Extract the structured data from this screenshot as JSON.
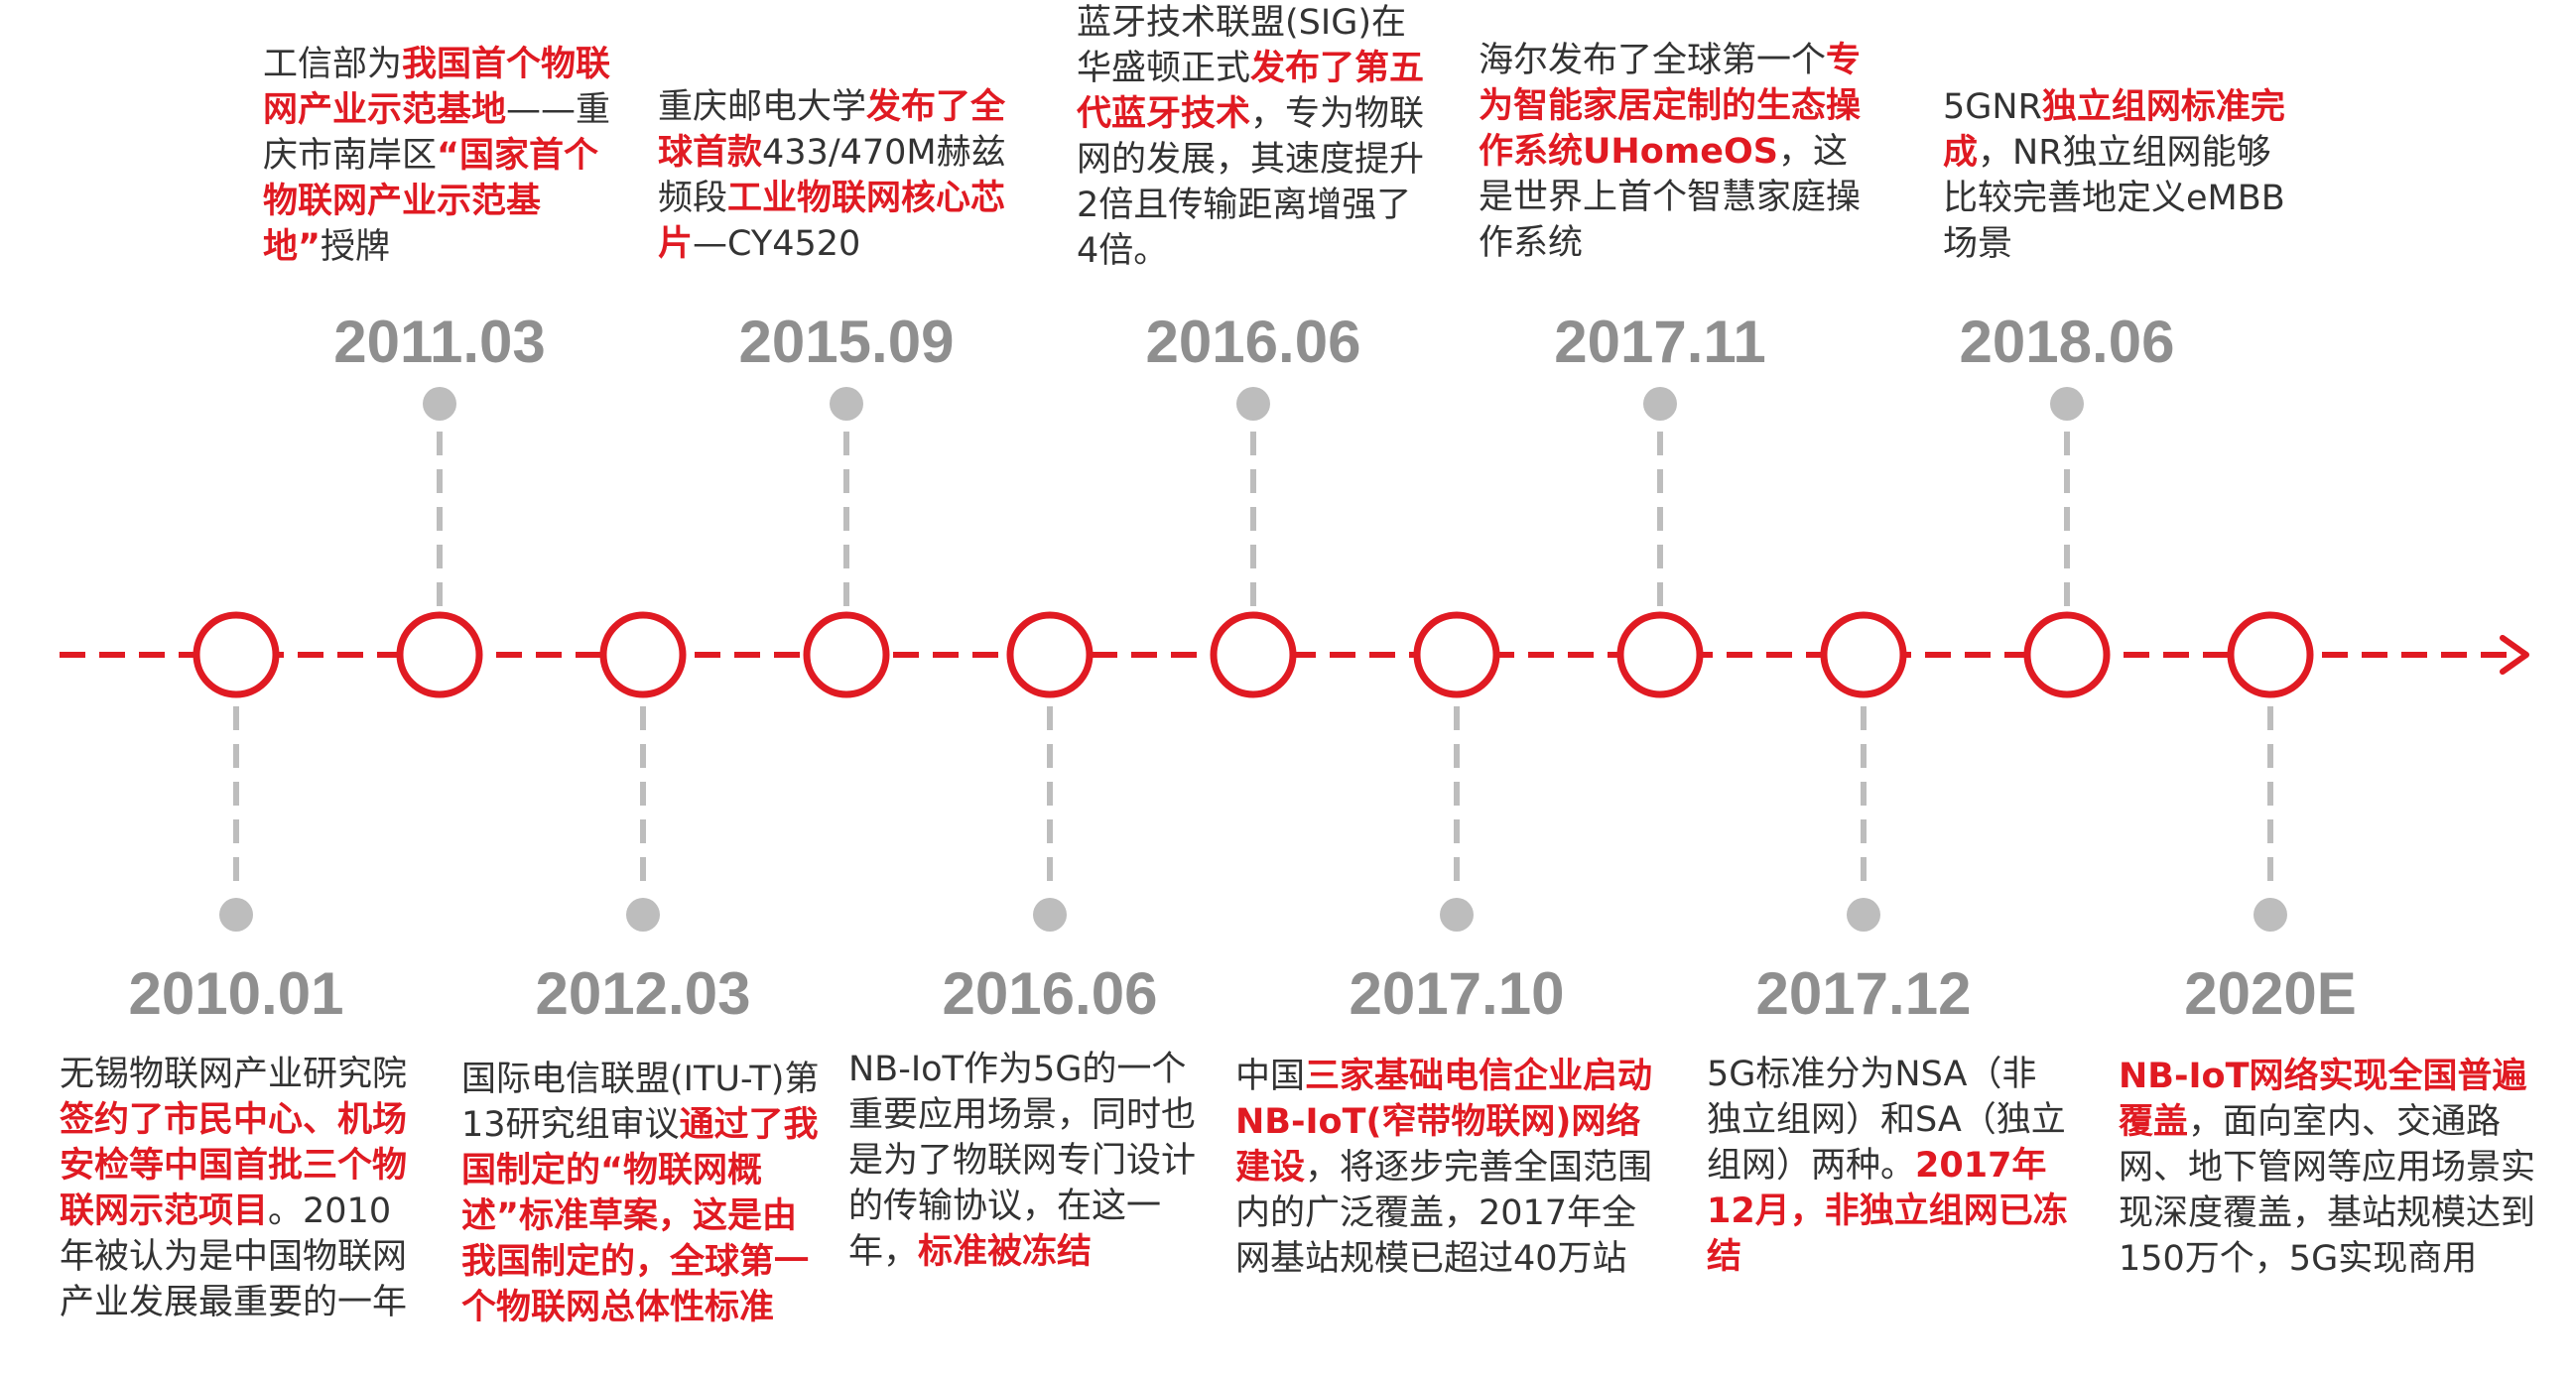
{
  "colors": {
    "accent": "#e01a22",
    "connector": "#bdbdbd",
    "year": "#8f8f8f",
    "text": "#333333"
  },
  "events": [
    {
      "date": "2010.01",
      "position": "below",
      "parts": [
        {
          "t": "无锡物联网产业研究院",
          "h": false
        },
        {
          "t": "签约了市民中心、机场安检等中国首批三个物联网示范项目",
          "h": true
        },
        {
          "t": "。2010年被认为是中国物联网产业发展最重要的一年",
          "h": false
        }
      ]
    },
    {
      "date": "2011.03",
      "position": "above",
      "parts": [
        {
          "t": "工信部为",
          "h": false
        },
        {
          "t": "我国首个物联网产业示范基地",
          "h": true
        },
        {
          "t": "——重庆市南岸区",
          "h": false
        },
        {
          "t": "“国家首个物联网产业示范基地”",
          "h": true
        },
        {
          "t": "授牌",
          "h": false
        }
      ]
    },
    {
      "date": "2012.03",
      "position": "below",
      "parts": [
        {
          "t": "国际电信联盟(ITU-T)第13研究组审议",
          "h": false
        },
        {
          "t": "通过了我国制定的“物联网概述”标准草案，这是由我国制定的，全球第一个物联网总体性标准",
          "h": true
        }
      ]
    },
    {
      "date": "2015.09",
      "position": "above",
      "parts": [
        {
          "t": "重庆邮电大学",
          "h": false
        },
        {
          "t": "发布了全球首款",
          "h": true
        },
        {
          "t": "433/470M赫兹频段",
          "h": false
        },
        {
          "t": "工业物联网核心芯片",
          "h": true
        },
        {
          "t": "—CY4520",
          "h": false
        }
      ]
    },
    {
      "date": "2016.06",
      "position": "below",
      "parts": [
        {
          "t": "NB-IoT作为5G的一个重要应用场景，同时也是为了物联网专门设计的传输协议，在这一年，",
          "h": false
        },
        {
          "t": "标准被冻结",
          "h": true
        }
      ]
    },
    {
      "date": "2016.06",
      "position": "above",
      "parts": [
        {
          "t": "蓝牙技术联盟(SIG)在华盛顿正式",
          "h": false
        },
        {
          "t": "发布了第五代蓝牙技术",
          "h": true
        },
        {
          "t": "，专为物联网的发展，其速度提升2倍且传输距离增强了4倍。",
          "h": false
        }
      ]
    },
    {
      "date": "2017.10",
      "position": "below",
      "parts": [
        {
          "t": "中国",
          "h": false
        },
        {
          "t": "三家基础电信企业启动NB-IoT(窄带物联网)网络建设",
          "h": true
        },
        {
          "t": "，将逐步完善全国范围内的广泛覆盖，2017年全网基站规模已超过40万站",
          "h": false
        }
      ]
    },
    {
      "date": "2017.11",
      "position": "above",
      "parts": [
        {
          "t": "海尔发布了全球第一个",
          "h": false
        },
        {
          "t": "专为智能家居定制的生态操作系统UHomeOS",
          "h": true
        },
        {
          "t": "，这是世界上首个智慧家庭操作系统",
          "h": false
        }
      ]
    },
    {
      "date": "2017.12",
      "position": "below",
      "parts": [
        {
          "t": "5G标准分为NSA（非独立组网）和SA（独立组网）两种。",
          "h": false
        },
        {
          "t": "2017年12月，非独立组网已冻结",
          "h": true
        }
      ]
    },
    {
      "date": "2018.06",
      "position": "above",
      "parts": [
        {
          "t": "5GNR",
          "h": false
        },
        {
          "t": "独立组网标准完成",
          "h": true
        },
        {
          "t": "，NR独立组网能够比较完善地定义eMBB场景",
          "h": false
        }
      ]
    },
    {
      "date": "2020E",
      "position": "below",
      "parts": [
        {
          "t": "NB-IoT网络实现全国普遍覆盖",
          "h": true
        },
        {
          "t": "，面向室内、交通路网、地下管网等应用场景实现深度覆盖，基站规模达到150万个，5G实现商用",
          "h": false
        }
      ]
    }
  ]
}
